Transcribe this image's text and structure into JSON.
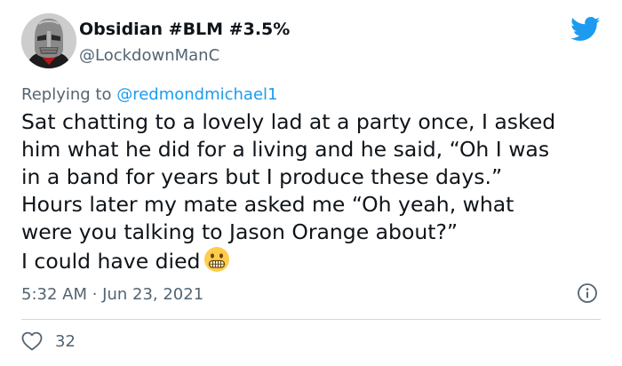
{
  "author": {
    "display_name": "Obsidian #BLM #3.5%",
    "handle": "@LockdownManC"
  },
  "reply": {
    "prefix": "Replying to ",
    "mention": "@redmondmichael1"
  },
  "tweet": {
    "lines": [
      "Sat chatting to a lovely lad at a party once, I asked",
      "him what he did for a living and he said, “Oh I was",
      "in a band for years but I produce these days.”",
      "Hours later my mate asked me “Oh yeah, what",
      "were you talking to Jason Orange about?”",
      "I could have died"
    ],
    "emoji": "grimacing-face-emoji"
  },
  "meta": {
    "timestamp": "5:32 AM · Jun 23, 2021"
  },
  "actions": {
    "like_count": "32"
  },
  "icons": {
    "logo": "twitter-bird-icon",
    "info": "info-icon",
    "like": "heart-icon"
  },
  "colors": {
    "brand": "#1d9bf0",
    "text": "#0f1419",
    "secondary": "#536471",
    "divider": "#cfd9de"
  }
}
